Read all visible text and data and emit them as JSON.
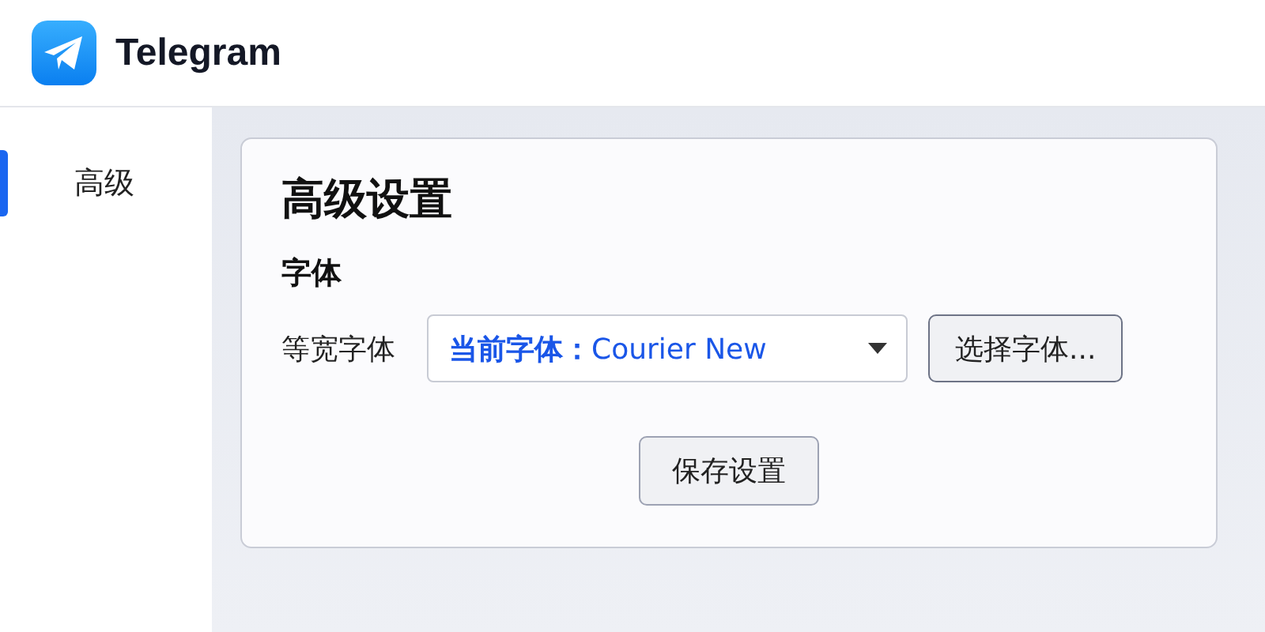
{
  "app": {
    "name": "Telegram"
  },
  "sidebar": {
    "items": [
      {
        "label": "高级",
        "selected": true
      }
    ]
  },
  "panel": {
    "title": "高级设置",
    "section": "字体",
    "font_row": {
      "label": "等宽字体",
      "select_value": "**当前字体：**Courier New",
      "button": "选择字体..."
    },
    "save_button": "保存设置"
  }
}
